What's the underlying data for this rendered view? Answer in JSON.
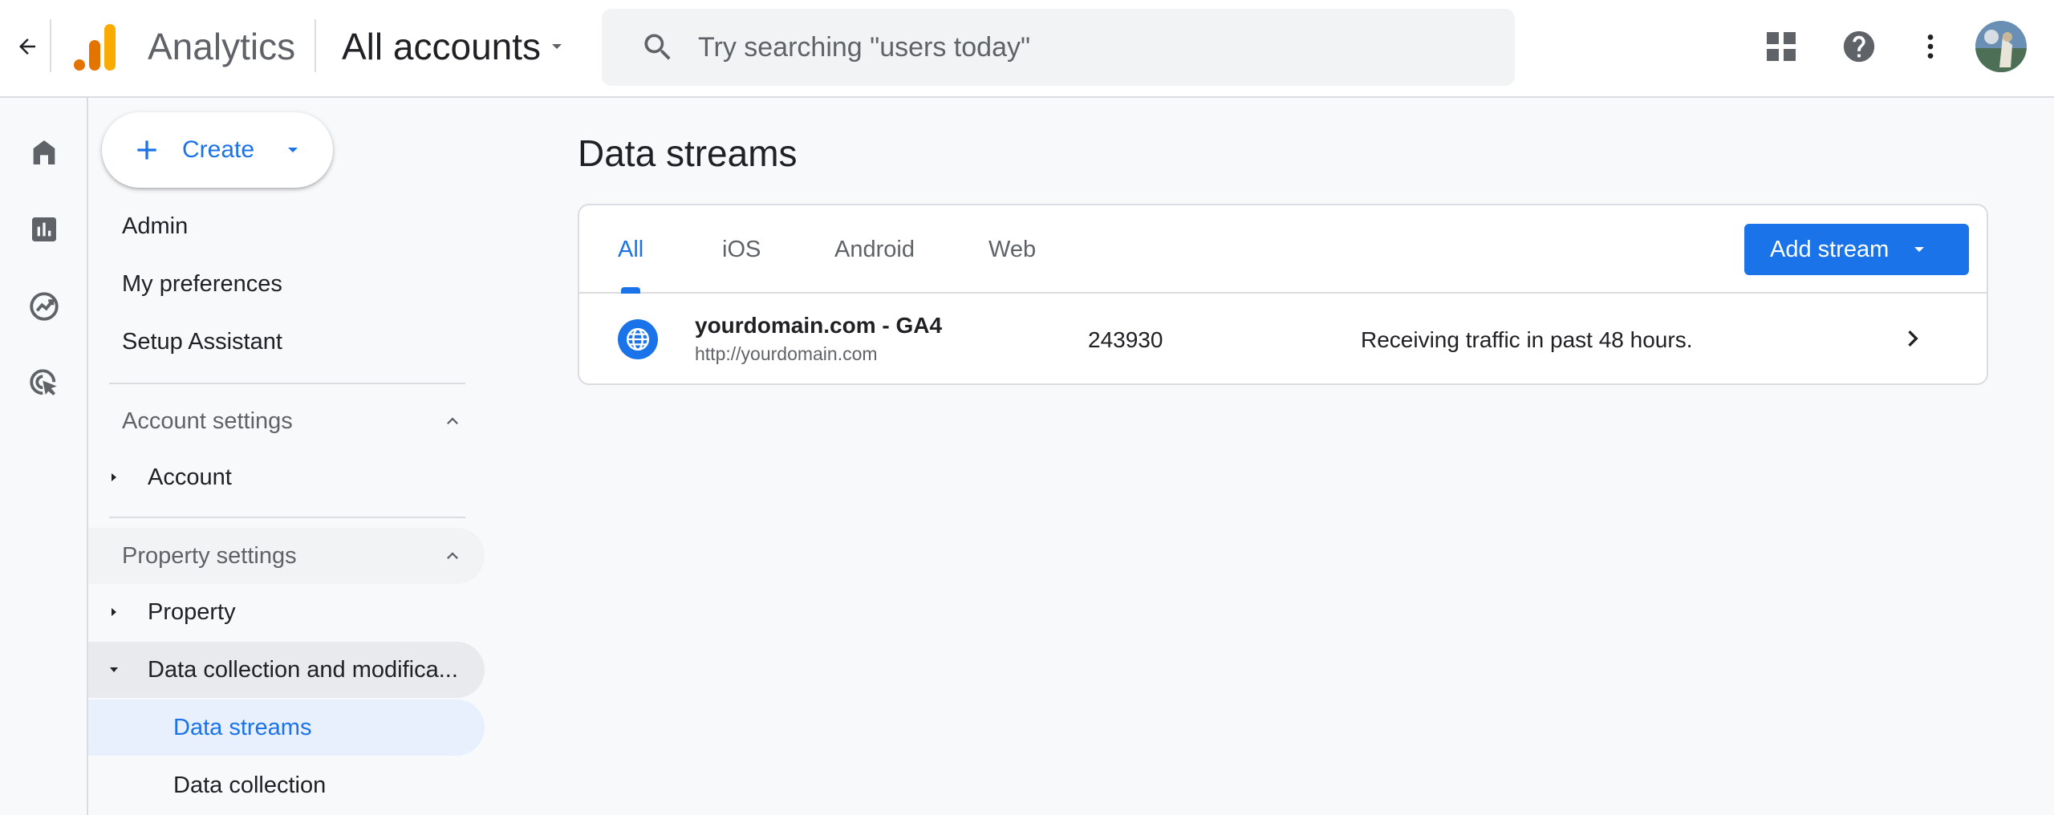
{
  "header": {
    "app_name": "Analytics",
    "account_picker": "All accounts",
    "search_placeholder": "Try searching \"users today\""
  },
  "icons": {
    "back": "arrow-back-icon",
    "logo": "analytics-logo",
    "search": "search-icon",
    "apps": "apps-grid-icon",
    "help": "help-icon",
    "more": "more-vert-icon",
    "rail": [
      "home-icon",
      "reports-icon",
      "explore-icon",
      "advertising-icon"
    ]
  },
  "colors": {
    "accent": "#1a73e8",
    "logo_orange": "#f9ab00",
    "logo_dark_orange": "#e37400",
    "selected_bg": "#e8f0fe"
  },
  "sidebar": {
    "create_label": "Create",
    "links": [
      "Admin",
      "My preferences",
      "Setup Assistant"
    ],
    "account_section": {
      "label": "Account settings",
      "items": [
        "Account"
      ]
    },
    "property_section": {
      "label": "Property settings",
      "property": "Property",
      "data_collection": "Data collection and modifica...",
      "sub_items": [
        "Data streams",
        "Data collection"
      ],
      "selected": "Data streams"
    }
  },
  "main": {
    "title": "Data streams",
    "tabs": [
      "All",
      "iOS",
      "Android",
      "Web"
    ],
    "active_tab": "All",
    "add_stream_label": "Add stream",
    "streams": [
      {
        "name": "yourdomain.com - GA4",
        "url": "http://yourdomain.com",
        "id": "243930",
        "status": "Receiving traffic in past 48 hours."
      }
    ]
  }
}
